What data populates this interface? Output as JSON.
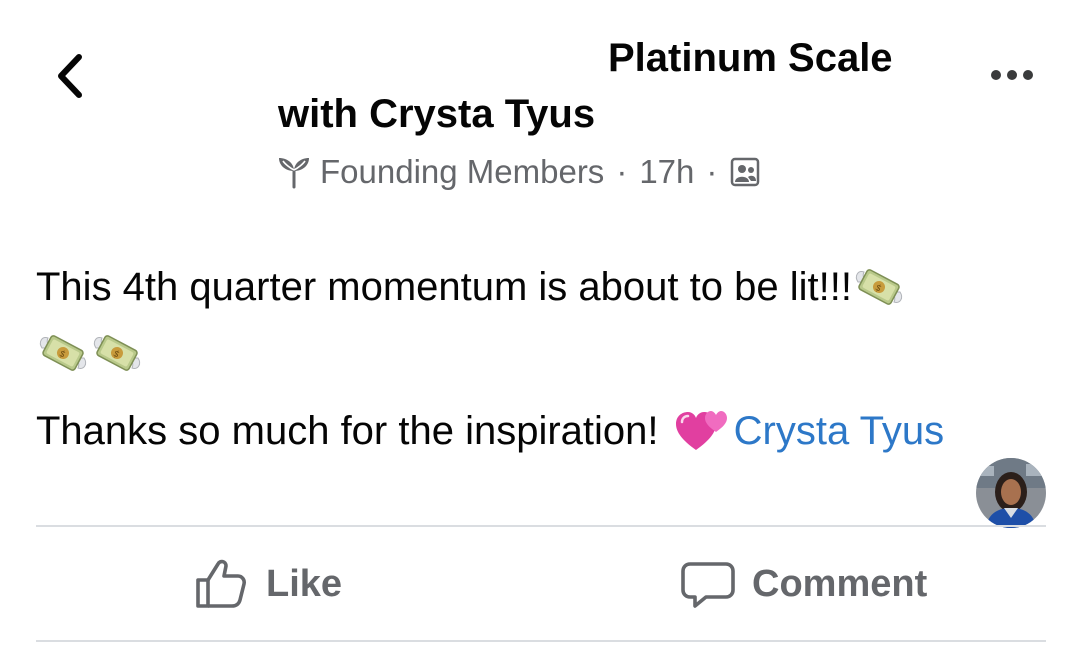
{
  "header": {
    "title_line1": "Platinum Scale",
    "title_line2": "with Crysta Tyus",
    "back_icon": "chevron-left-icon",
    "more_icon": "more-horizontal-icon"
  },
  "meta": {
    "badge_icon": "sprout-icon",
    "group_label": "Founding Members",
    "separator": "·",
    "time": "17h",
    "audience_icon": "members-only-icon"
  },
  "post": {
    "line1_text": "This 4th quarter momentum is about to be lit!!!",
    "line1_emoji": "money-with-wings",
    "line2_emoji_count": 2,
    "line3_text": "Thanks so much for the inspiration!",
    "line3_emoji": "two-hearts",
    "mention": "Crysta Tyus"
  },
  "actions": {
    "like_label": "Like",
    "comment_label": "Comment"
  },
  "colors": {
    "mention": "#2d78c8",
    "secondary_text": "#65676b",
    "primary_text": "#050505",
    "divider": "#dadde1"
  }
}
